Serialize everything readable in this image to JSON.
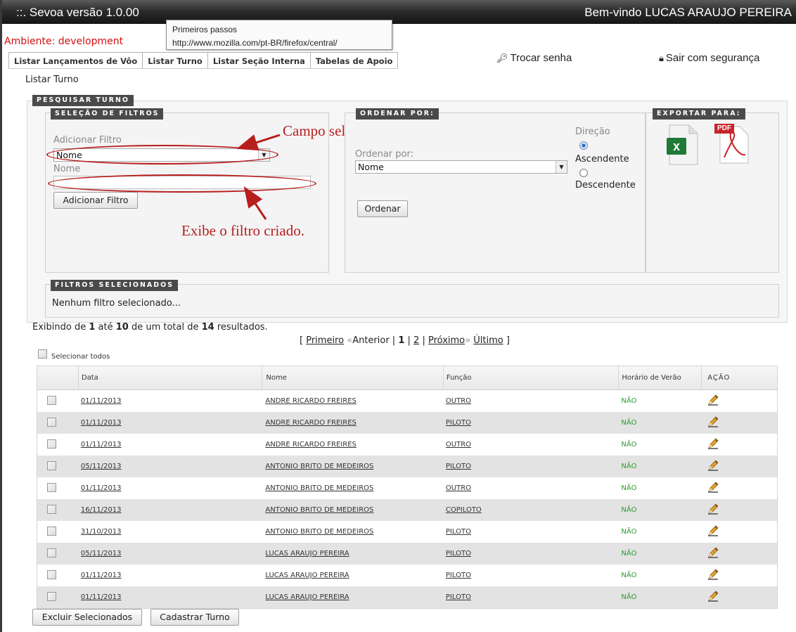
{
  "header": {
    "app_title": "::.  Sevoa versão 1.0.00",
    "welcome": "Bem-vindo LUCAS ARAUJO PEREIRA"
  },
  "tooltip": {
    "line1": "Primeiros passos",
    "line2": "http://www.mozilla.com/pt-BR/firefox/central/"
  },
  "env_label": "Ambiente: development",
  "tabs": [
    {
      "label": "Listar Lançamentos de Vôo"
    },
    {
      "label": "Listar Turno"
    },
    {
      "label": "Listar Seção Interna"
    },
    {
      "label": "Tabelas de Apoio"
    }
  ],
  "links": {
    "change_password": "Trocar senha",
    "logout": "Sair com segurança"
  },
  "page_title": "Listar Turno",
  "search": {
    "legend": "PESQUISAR TURNO",
    "filters": {
      "legend": "SELEÇÃO DE FILTROS",
      "add_filter_label": "Adicionar Filtro",
      "field_select_value": "Nome",
      "name_label": "Nome",
      "name_value": "",
      "add_button": "Adicionar Filtro"
    },
    "order": {
      "legend": "ORDENAR POR:",
      "order_label": "Ordenar por:",
      "order_value": "Nome",
      "direction_label": "Direção",
      "asc": "Ascendente",
      "desc": "Descendente",
      "selected_direction": "Ascendente",
      "order_button": "Ordenar"
    },
    "export": {
      "legend": "EXPORTAR PARA:",
      "pdf_text": "PDF"
    },
    "selected_filters": {
      "legend": "FILTROS SELECIONADOS",
      "empty_text": "Nenhum filtro selecionado..."
    }
  },
  "annotations": {
    "field_selected": "Campo selecionado",
    "filter_created": "Exibe o filtro criado."
  },
  "results": {
    "prefix": "Exibindo de ",
    "from": "1",
    "mid1": " até ",
    "to": "10",
    "mid2": " de um total de ",
    "total": "14",
    "suffix": " resultados."
  },
  "pager": {
    "open": "[ ",
    "first": "Primeiro",
    "prev_arrow": "«",
    "prev": "Anterior",
    "sep1": " | ",
    "page1": "1",
    "sep2": " | ",
    "page2": "2",
    "sep3": " | ",
    "next": "Próximo",
    "next_arrow": "»",
    "last": "Último",
    "close": " ]"
  },
  "select_all": "Selecionar todos",
  "table": {
    "headers": {
      "data": "Data",
      "nome": "Nome",
      "funcao": "Função",
      "horario": "Horário de Verão",
      "acao": "AÇÃO"
    },
    "rows": [
      {
        "data": "01/11/2013",
        "nome": "ANDRE RICARDO FREIRES",
        "funcao": "OUTRO",
        "horario": "NÃO"
      },
      {
        "data": "01/11/2013",
        "nome": "ANDRE RICARDO FREIRES",
        "funcao": "PILOTO",
        "horario": "NÃO"
      },
      {
        "data": "01/11/2013",
        "nome": "ANDRE RICARDO FREIRES",
        "funcao": "OUTRO",
        "horario": "NÃO"
      },
      {
        "data": "05/11/2013",
        "nome": "ANTONIO BRITO DE MEDEIROS",
        "funcao": "PILOTO",
        "horario": "NÃO"
      },
      {
        "data": "01/11/2013",
        "nome": "ANTONIO BRITO DE MEDEIROS",
        "funcao": "OUTRO",
        "horario": "NÃO"
      },
      {
        "data": "16/11/2013",
        "nome": "ANTONIO BRITO DE MEDEIROS",
        "funcao": "COPILOTO",
        "horario": "NÃO"
      },
      {
        "data": "31/10/2013",
        "nome": "ANTONIO BRITO DE MEDEIROS",
        "funcao": "PILOTO",
        "horario": "NÃO"
      },
      {
        "data": "05/11/2013",
        "nome": "LUCAS ARAUJO PEREIRA",
        "funcao": "PILOTO",
        "horario": "NÃO"
      },
      {
        "data": "01/11/2013",
        "nome": "LUCAS ARAUJO PEREIRA",
        "funcao": "PILOTO",
        "horario": "NÃO"
      },
      {
        "data": "01/11/2013",
        "nome": "LUCAS ARAUJO PEREIRA",
        "funcao": "PILOTO",
        "horario": "NÃO"
      }
    ]
  },
  "actions": {
    "delete_selected": "Excluir Selecionados",
    "create": "Cadastrar Turno"
  },
  "colors": {
    "env_red": "#d51010",
    "annotation_red": "#b81e1e",
    "yes_no_green": "#2e9a2e"
  },
  "icons": {
    "row_action": "edit-pencil-icon",
    "export_excel": "excel-icon",
    "export_pdf": "pdf-icon",
    "change_password": "key-icon",
    "logout": "lock-icon"
  }
}
